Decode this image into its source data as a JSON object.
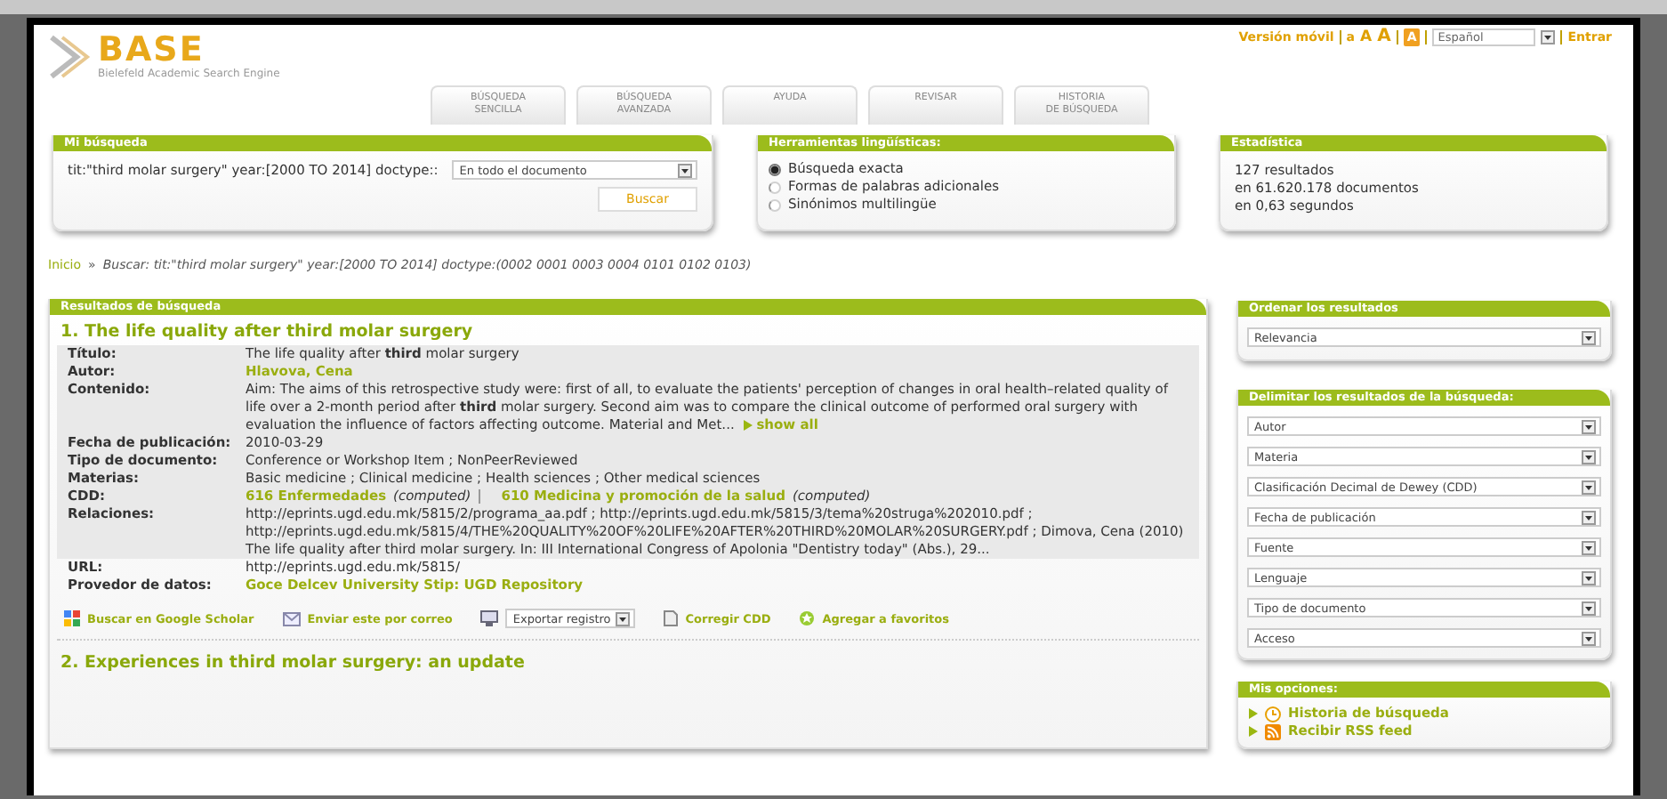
{
  "header": {
    "logo": "BASE",
    "tagline": "Bielefeld Academic Search Engine",
    "tabs": [
      {
        "label": "BÚSQUEDA\nSENCILLA"
      },
      {
        "label": "BÚSQUEDA\nAVANZADA"
      },
      {
        "label": "AYUDA"
      },
      {
        "label": "REVISAR"
      },
      {
        "label": "HISTORIA\nDE BÚSQUEDA"
      }
    ],
    "mobile_link": "Versión móvil",
    "font_sizes": [
      "a",
      "A",
      "A"
    ],
    "contrast": "A",
    "language": "Español",
    "login": "Entrar"
  },
  "search_box": {
    "title": "Mi búsqueda",
    "query": "tit:\"third molar surgery\" year:[2000 TO 2014] doctype::",
    "scope": "En todo el documento",
    "button": "Buscar"
  },
  "tools_box": {
    "title": "Herramientas lingüísticas:",
    "options": [
      {
        "label": "Búsqueda exacta",
        "selected": true
      },
      {
        "label": "Formas de palabras adicionales",
        "selected": false
      },
      {
        "label": "Sinónimos multilingüe",
        "selected": false
      }
    ]
  },
  "stats_box": {
    "title": "Estadística",
    "lines": [
      "127 resultados",
      "en 61.620.178 documentos",
      "en 0,63 segundos"
    ]
  },
  "breadcrumb": {
    "home": "Inicio",
    "separator": "»",
    "path": "Buscar: tit:\"third molar surgery\" year:[2000 TO 2014] doctype:(0002 0001 0003 0004 0101 0102 0103)"
  },
  "results": {
    "title": "Resultados de búsqueda",
    "items": [
      {
        "title": "1. The life quality after third molar surgery",
        "fields": [
          {
            "label": "Título:",
            "kind": "text",
            "shaded": true,
            "value": "The life quality after **third** molar surgery"
          },
          {
            "label": "Autor:",
            "kind": "link",
            "shaded": true,
            "value": "Hlavova, Cena"
          },
          {
            "label": "Contenido:",
            "kind": "abstract",
            "shaded": true,
            "value": "Aim: The aims of this retrospective study were: first of all, to evaluate the patients' perception of changes in oral health–related quality of life over a 2-month period after **third** molar surgery. Second aim was to compare the clinical outcome of performed oral surgery with evaluation the influence of factors affecting outcome. Material and Met...",
            "more": "show all"
          },
          {
            "label": "Fecha de publicación:",
            "kind": "text",
            "shaded": true,
            "value": "2010-03-29"
          },
          {
            "label": "Tipo de documento:",
            "kind": "text",
            "shaded": true,
            "value": "Conference or Workshop Item ; NonPeerReviewed"
          },
          {
            "label": "Materias:",
            "kind": "text",
            "shaded": true,
            "value": "Basic medicine ; Clinical medicine ; Health sciences ; Other medical sciences"
          },
          {
            "label": "CDD:",
            "kind": "classes",
            "shaded": true,
            "classes": [
              {
                "name": "616 Enfermedades",
                "note": "(computed)"
              },
              {
                "name": "610 Medicina y promoción de la salud",
                "note": "(computed)"
              }
            ]
          },
          {
            "label": "Relaciones:",
            "kind": "text",
            "shaded": true,
            "value": "http://eprints.ugd.edu.mk/5815/2/programa_aa.pdf ; http://eprints.ugd.edu.mk/5815/3/tema%20struga%202010.pdf ; http://eprints.ugd.edu.mk/5815/4/THE%20QUALITY%20OF%20LIFE%20AFTER%20THIRD%20MOLAR%20SURGERY.pdf ; Dimova, Cena (2010) The life quality after third molar surgery. In: III International Congress of Apolonia \"Dentistry today\" (Abs.), 29..."
          },
          {
            "label": "URL:",
            "kind": "text",
            "shaded": false,
            "value": "http://eprints.ugd.edu.mk/5815/"
          },
          {
            "label": "Provedor de datos:",
            "kind": "link",
            "shaded": false,
            "value": "Goce Delcev University Stip: UGD Repository"
          }
        ],
        "actions": [
          {
            "kind": "scholar",
            "label": "Buscar en Google Scholar"
          },
          {
            "kind": "mail",
            "label": "Enviar este por correo"
          },
          {
            "kind": "export",
            "label": "Exportar registro"
          },
          {
            "kind": "fix",
            "label": "Corregir CDD"
          },
          {
            "kind": "favorite",
            "label": "Agregar a favoritos"
          }
        ]
      },
      {
        "title": "2. Experiences in third molar surgery: an update"
      }
    ]
  },
  "sort_box": {
    "title": "Ordenar los resultados",
    "value": "Relevancia"
  },
  "filter_box": {
    "title": "Delimitar los resultados de la búsqueda:",
    "filters": [
      "Autor",
      "Materia",
      "Clasificación Decimal de Dewey (CDD)",
      "Fecha de publicación",
      "Fuente",
      "Lenguaje",
      "Tipo de documento",
      "Acceso"
    ]
  },
  "options_box": {
    "title": "Mis opciones:",
    "items": [
      {
        "kind": "history",
        "label": "Historia de búsqueda"
      },
      {
        "kind": "rss",
        "label": "Recibir RSS feed"
      }
    ]
  }
}
